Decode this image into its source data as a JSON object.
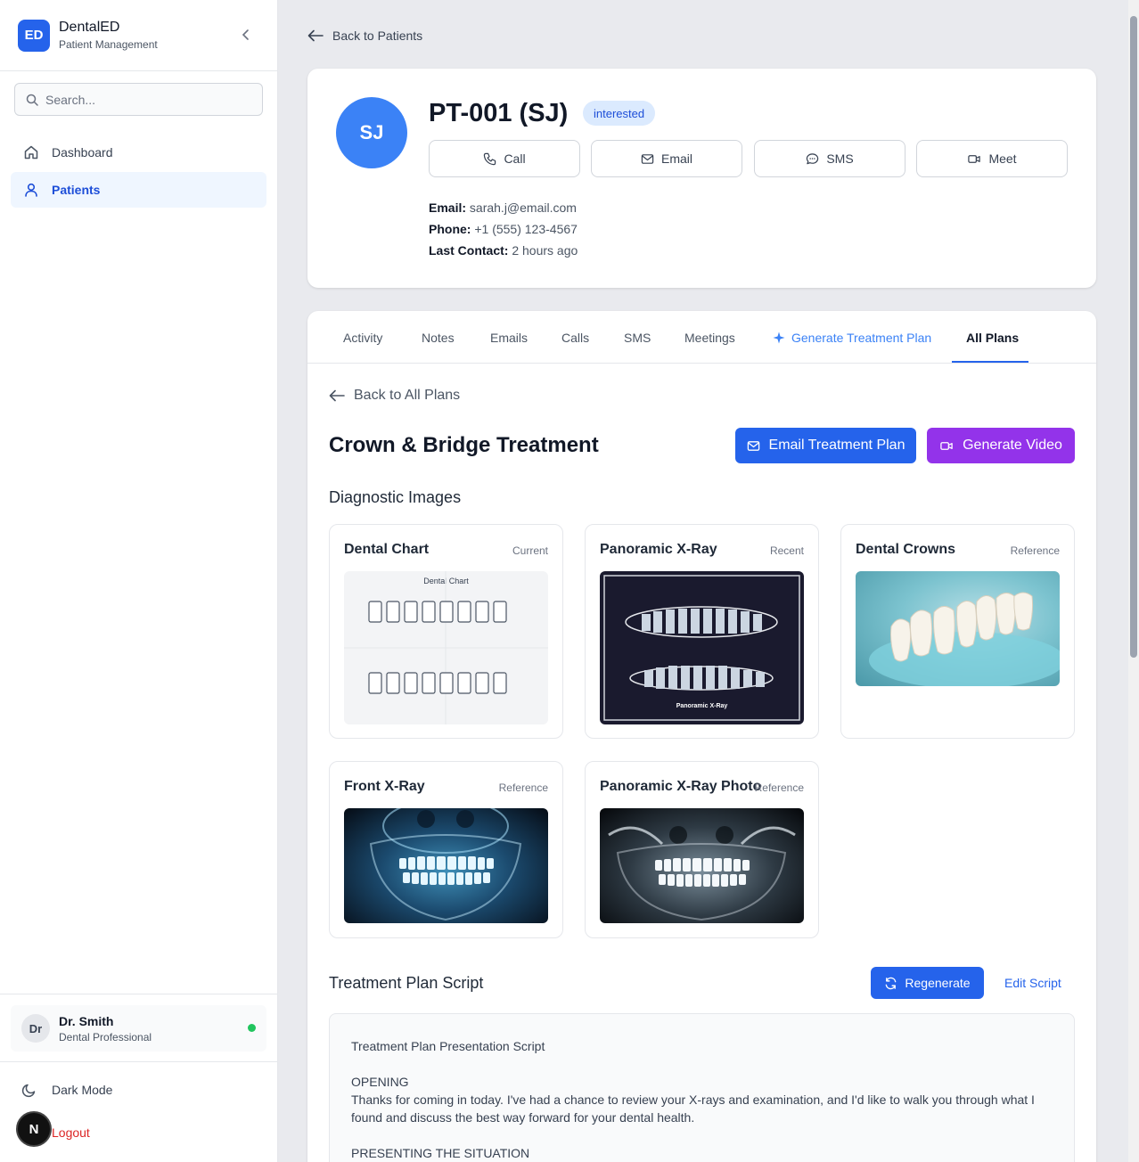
{
  "brand": {
    "logo": "ED",
    "title": "DentalED",
    "subtitle": "Patient Management"
  },
  "search": {
    "placeholder": "Search..."
  },
  "nav": [
    {
      "label": "Dashboard",
      "icon": "home-icon"
    },
    {
      "label": "Patients",
      "icon": "user-icon",
      "active": true
    }
  ],
  "user": {
    "initials": "Dr",
    "name": "Dr. Smith",
    "role": "Dental Professional",
    "status_color": "#22c55e"
  },
  "sidebar_bottom": {
    "dark_mode": "Dark Mode",
    "logout": "Logout",
    "badge": "N"
  },
  "back_link": "Back to Patients",
  "patient": {
    "initials": "SJ",
    "title": "PT-001 (SJ)",
    "status": "interested",
    "actions": [
      "Call",
      "Email",
      "SMS",
      "Meet"
    ],
    "email_label": "Email:",
    "email": "sarah.j@email.com",
    "phone_label": "Phone:",
    "phone": "+1 (555) 123-4567",
    "last_contact_label": "Last Contact:",
    "last_contact": "2 hours ago"
  },
  "tabs": [
    "Activity",
    "Notes",
    "Emails",
    "Calls",
    "SMS",
    "Meetings",
    "Generate Treatment Plan",
    "All Plans"
  ],
  "active_tab": "All Plans",
  "plan": {
    "back": "Back to All Plans",
    "title": "Crown & Bridge Treatment",
    "email_btn": "Email Treatment Plan",
    "video_btn": "Generate Video",
    "images_title": "Diagnostic Images",
    "images": [
      {
        "title": "Dental Chart",
        "tag": "Current",
        "caption": "Dental Chart"
      },
      {
        "title": "Panoramic X-Ray",
        "tag": "Recent",
        "caption": "Panoramic X-Ray"
      },
      {
        "title": "Dental Crowns",
        "tag": "Reference"
      },
      {
        "title": "Front X-Ray",
        "tag": "Reference"
      },
      {
        "title": "Panoramic X-Ray Photo",
        "tag": "Reference"
      }
    ],
    "script_title": "Treatment Plan Script",
    "regenerate": "Regenerate",
    "edit_script": "Edit Script",
    "script": {
      "heading": "Treatment Plan Presentation Script",
      "opening_label": "OPENING",
      "opening": "Thanks for coming in today. I've had a chance to review your X-rays and examination, and I'd like to walk you through what I found and discuss the best way forward for your dental health.",
      "presenting_label": "PRESENTING THE SITUATION"
    }
  },
  "colors": {
    "primary": "#2563eb",
    "purple": "#9333ea",
    "avatar": "#3b82f6"
  }
}
